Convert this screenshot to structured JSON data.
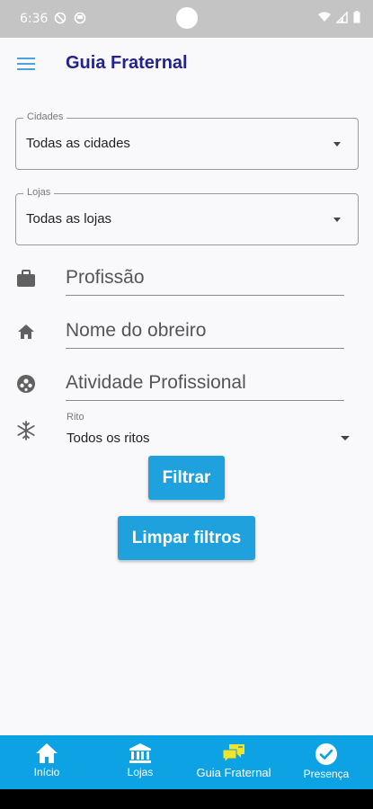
{
  "status_bar": {
    "time": "6:36"
  },
  "app_bar": {
    "title": "Guia Fraternal"
  },
  "filters": {
    "cidades": {
      "label": "Cidades",
      "value": "Todas as cidades"
    },
    "lojas": {
      "label": "Lojas",
      "value": "Todas as lojas"
    },
    "profissao": {
      "placeholder": "Profissão"
    },
    "obreiro": {
      "placeholder": "Nome do obreiro"
    },
    "atividade": {
      "placeholder": "Atividade Profissional"
    },
    "rito": {
      "label": "Rito",
      "value": "Todos os ritos"
    }
  },
  "buttons": {
    "filtrar": "Filtrar",
    "limpar": "Limpar filtros"
  },
  "bottom_nav": {
    "items": [
      {
        "label": "Início",
        "icon": "home-icon",
        "active": false
      },
      {
        "label": "Lojas",
        "icon": "bank-icon",
        "active": false
      },
      {
        "label": "Guia Fraternal",
        "icon": "chat-icon",
        "active": true
      },
      {
        "label": "Presença",
        "icon": "check-circle-icon",
        "active": false
      }
    ]
  },
  "colors": {
    "accent": "#1ea1dc",
    "nav_bg": "#0da2e3",
    "title": "#23238c",
    "active_icon": "#f5e327"
  }
}
